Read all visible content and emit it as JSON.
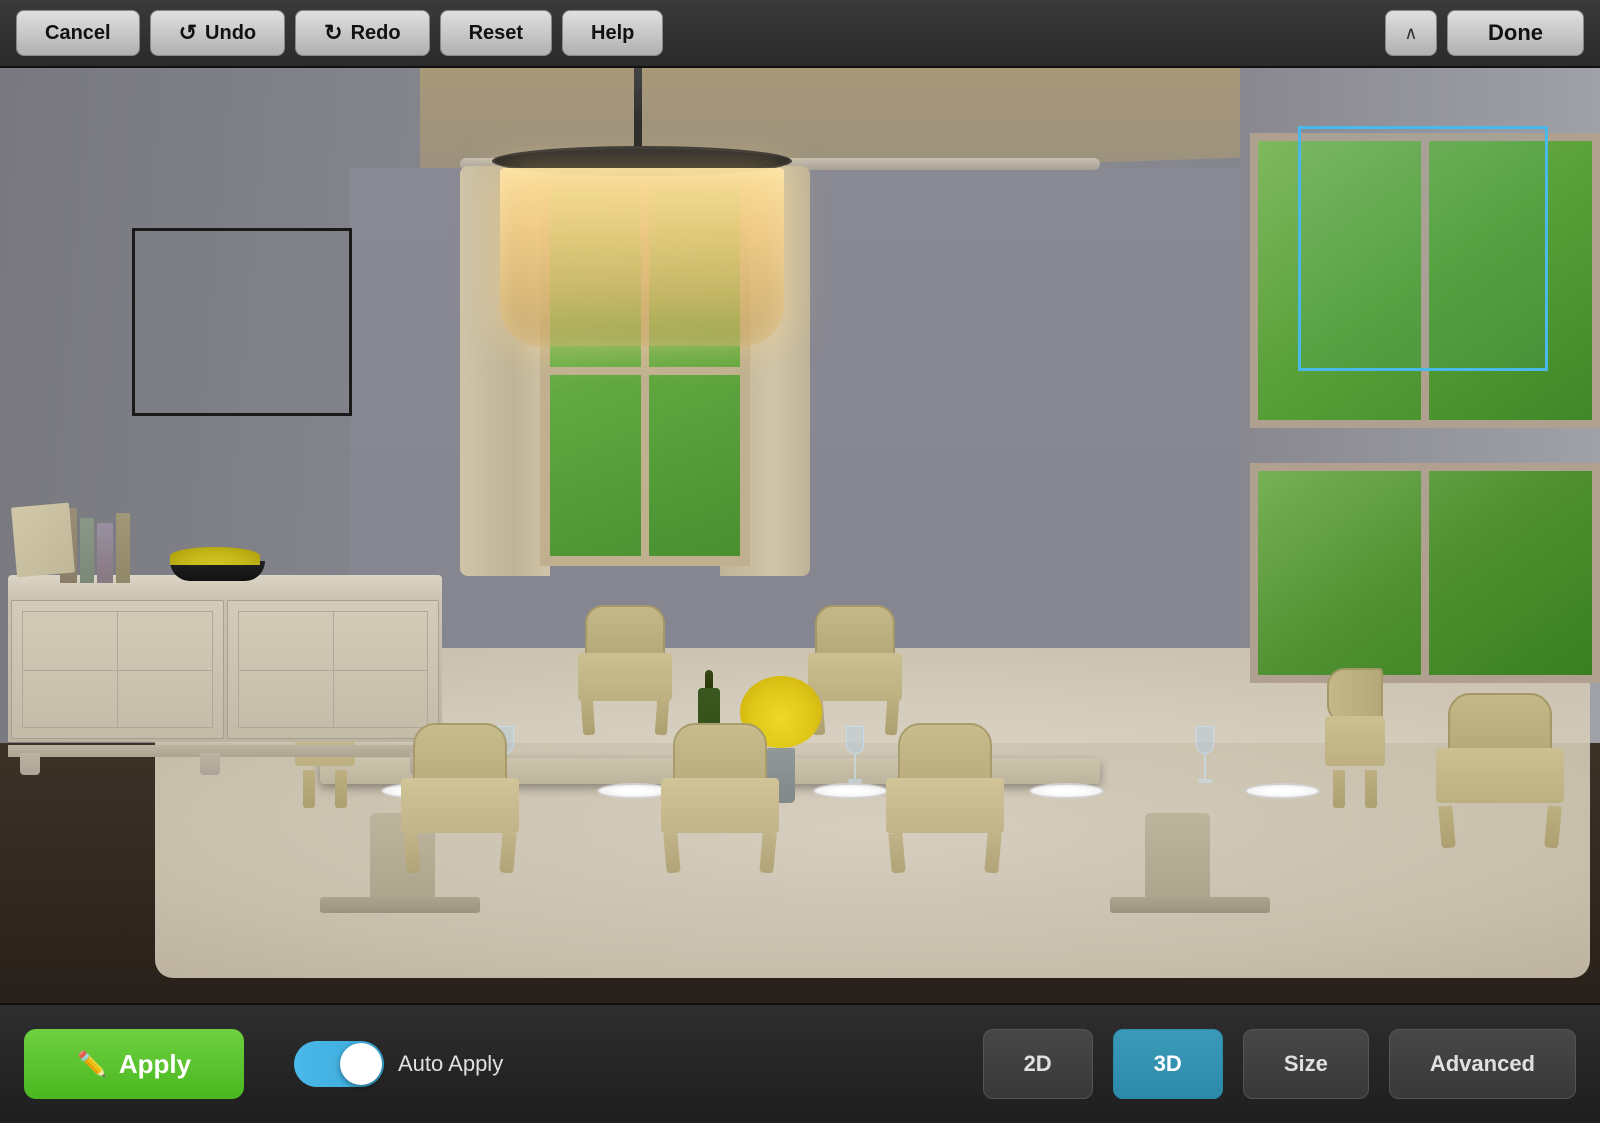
{
  "toolbar": {
    "cancel_label": "Cancel",
    "undo_label": "Undo",
    "redo_label": "Redo",
    "reset_label": "Reset",
    "help_label": "Help",
    "done_label": "Done",
    "chevron_icon": "chevron-up"
  },
  "bottom_toolbar": {
    "apply_label": "Apply",
    "auto_apply_label": "Auto Apply",
    "toggle_state": "on",
    "view_2d_label": "2D",
    "view_3d_label": "3D",
    "size_label": "Size",
    "advanced_label": "Advanced",
    "active_view": "3D"
  },
  "colors": {
    "apply_green": "#5bc827",
    "toggle_blue": "#4ab8e8",
    "active_view_blue": "#2a8aa8",
    "selection_blue": "#4ab8e8",
    "toolbar_bg": "#2e2e2e",
    "top_toolbar_bg": "#333333"
  }
}
